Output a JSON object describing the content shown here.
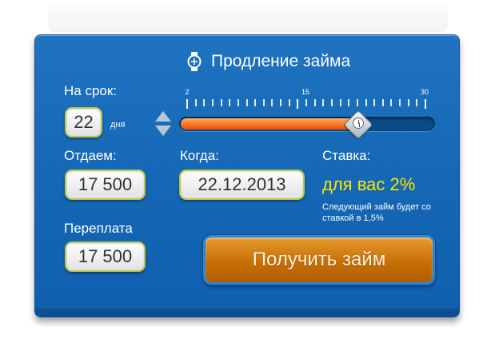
{
  "header": {
    "title": "Продление займа",
    "icon": "watch-icon"
  },
  "term": {
    "label": "На срок:",
    "value": "22",
    "unit": "дня"
  },
  "slider": {
    "min_label": "2",
    "mid_label": "15",
    "max_label": "30",
    "min": 2,
    "max": 30,
    "value": 22
  },
  "give": {
    "label": "Отдаем:",
    "value": "17 500"
  },
  "when": {
    "label": "Когда:",
    "value": "22.12.2013"
  },
  "rate": {
    "label": "Ставка:",
    "value": "для вас 2%",
    "note": "Следующий займ будет со ставкой в 1,5%"
  },
  "overpay": {
    "label": "Переплата",
    "value": "17 500"
  },
  "cta": {
    "label": "Получить займ"
  },
  "colors": {
    "panel": "#1669b6",
    "accent_yellow": "#ffe600",
    "slider_fill": "#ff7a1f",
    "button": "#c86f07"
  }
}
